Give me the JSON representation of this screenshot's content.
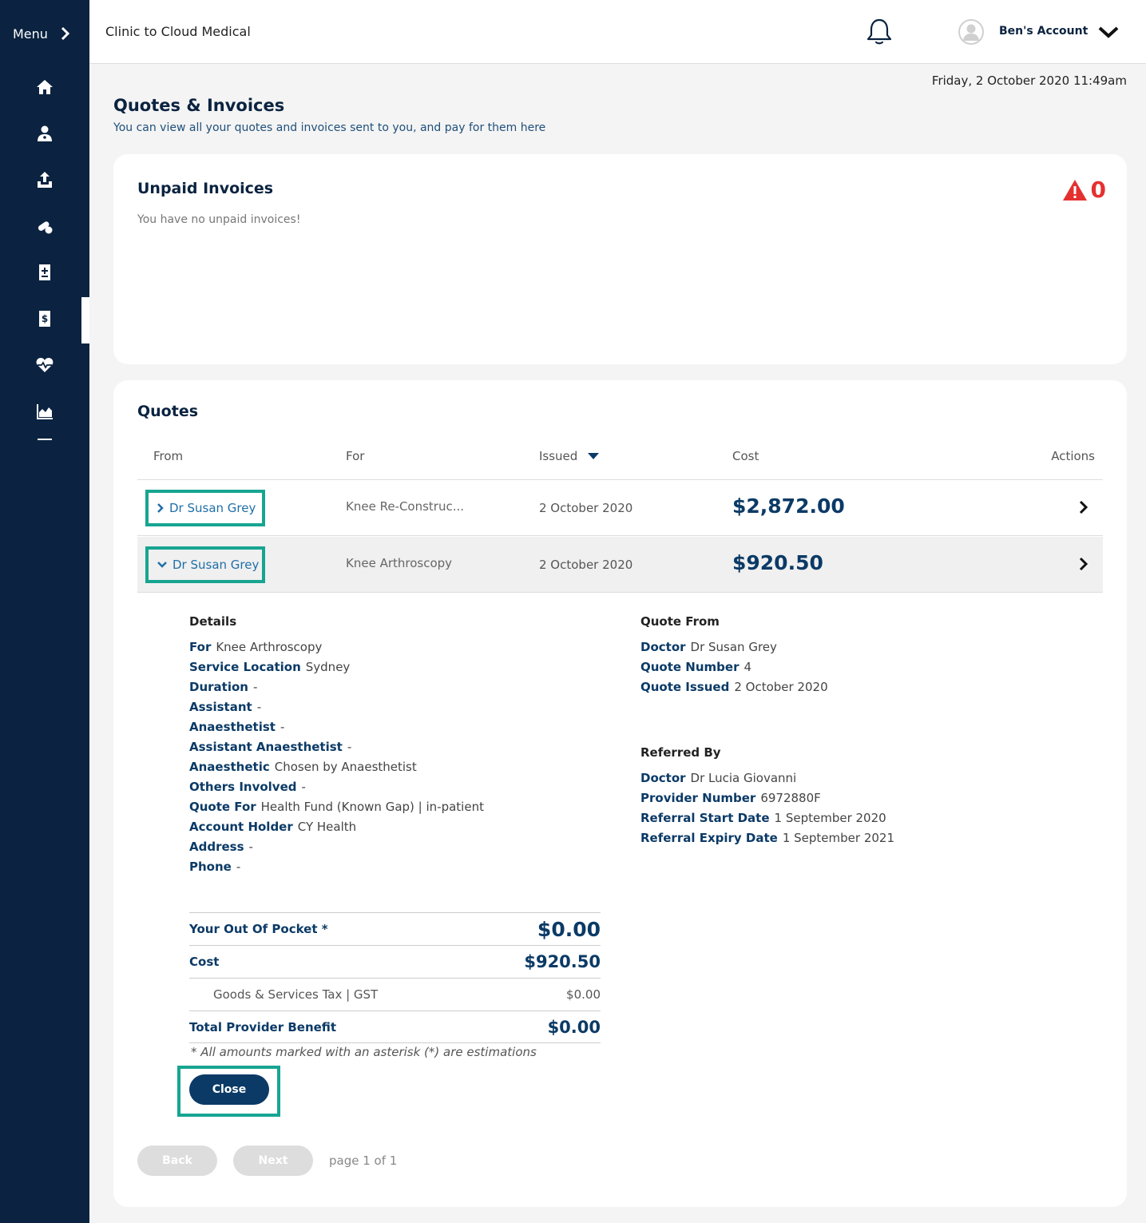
{
  "sidebar": {
    "menu_label": "Menu",
    "items": [
      {
        "icon": "home-icon"
      },
      {
        "icon": "doctor-icon"
      },
      {
        "icon": "upload-icon"
      },
      {
        "icon": "pills-icon"
      },
      {
        "icon": "medical-record-icon"
      },
      {
        "icon": "invoice-icon",
        "active": true
      },
      {
        "icon": "heart-rate-icon"
      },
      {
        "icon": "chart-icon"
      }
    ]
  },
  "header": {
    "clinic_name": "Clinic to Cloud Medical",
    "account_name": "Ben's Account"
  },
  "datetime": "Friday, 2 October 2020 11:49am",
  "page": {
    "title": "Quotes & Invoices",
    "subtitle": "You can view all your quotes and invoices sent to you, and pay for them here"
  },
  "unpaid": {
    "title": "Unpaid Invoices",
    "empty_text": "You have no unpaid invoices!",
    "count": "0",
    "alert_color": "#e53030"
  },
  "quotes": {
    "title": "Quotes",
    "columns": {
      "from": "From",
      "for": "For",
      "issued": "Issued",
      "cost": "Cost",
      "actions": "Actions"
    },
    "rows": [
      {
        "from": "Dr Susan Grey",
        "for": "Knee Re-Construc...",
        "issued": "2 October 2020",
        "cost": "$2,872.00",
        "expanded": false
      },
      {
        "from": "Dr Susan Grey",
        "for": "Knee Arthroscopy",
        "issued": "2 October 2020",
        "cost": "$920.50",
        "expanded": true
      }
    ],
    "details": {
      "heading": "Details",
      "fields": [
        {
          "label": "For",
          "value": "Knee Arthroscopy"
        },
        {
          "label": "Service Location",
          "value": "Sydney"
        },
        {
          "label": "Duration",
          "value": "-"
        },
        {
          "label": "Assistant",
          "value": "-"
        },
        {
          "label": "Anaesthetist",
          "value": "-"
        },
        {
          "label": "Assistant Anaesthetist",
          "value": "-"
        },
        {
          "label": "Anaesthetic",
          "value": "Chosen by Anaesthetist"
        },
        {
          "label": "Others Involved",
          "value": "-"
        },
        {
          "label": "Quote For",
          "value": "Health Fund (Known Gap) | in-patient"
        },
        {
          "label": "Account Holder",
          "value": "CY Health"
        },
        {
          "label": "Address",
          "value": "-"
        },
        {
          "label": "Phone",
          "value": "-"
        }
      ]
    },
    "quote_from": {
      "heading": "Quote From",
      "fields": [
        {
          "label": "Doctor",
          "value": "Dr Susan Grey"
        },
        {
          "label": "Quote Number",
          "value": "4"
        },
        {
          "label": "Quote Issued",
          "value": "2 October 2020"
        }
      ]
    },
    "referred_by": {
      "heading": "Referred By",
      "fields": [
        {
          "label": "Doctor",
          "value": "Dr Lucia Giovanni"
        },
        {
          "label": "Provider Number",
          "value": "6972880F"
        },
        {
          "label": "Referral Start Date",
          "value": "1 September 2020"
        },
        {
          "label": "Referral Expiry Date",
          "value": "1 September 2021"
        }
      ]
    },
    "summary": {
      "out_of_pocket_label": "Your Out Of Pocket *",
      "out_of_pocket_value": "$0.00",
      "cost_label": "Cost",
      "cost_value": "$920.50",
      "gst_label": "Goods & Services Tax | GST",
      "gst_value": "$0.00",
      "benefit_label": "Total Provider Benefit",
      "benefit_value": "$0.00",
      "note": "* All amounts marked with an asterisk (*) are estimations"
    },
    "close_label": "Close",
    "pagination": {
      "back": "Back",
      "next": "Next",
      "label": "page 1 of 1"
    }
  }
}
